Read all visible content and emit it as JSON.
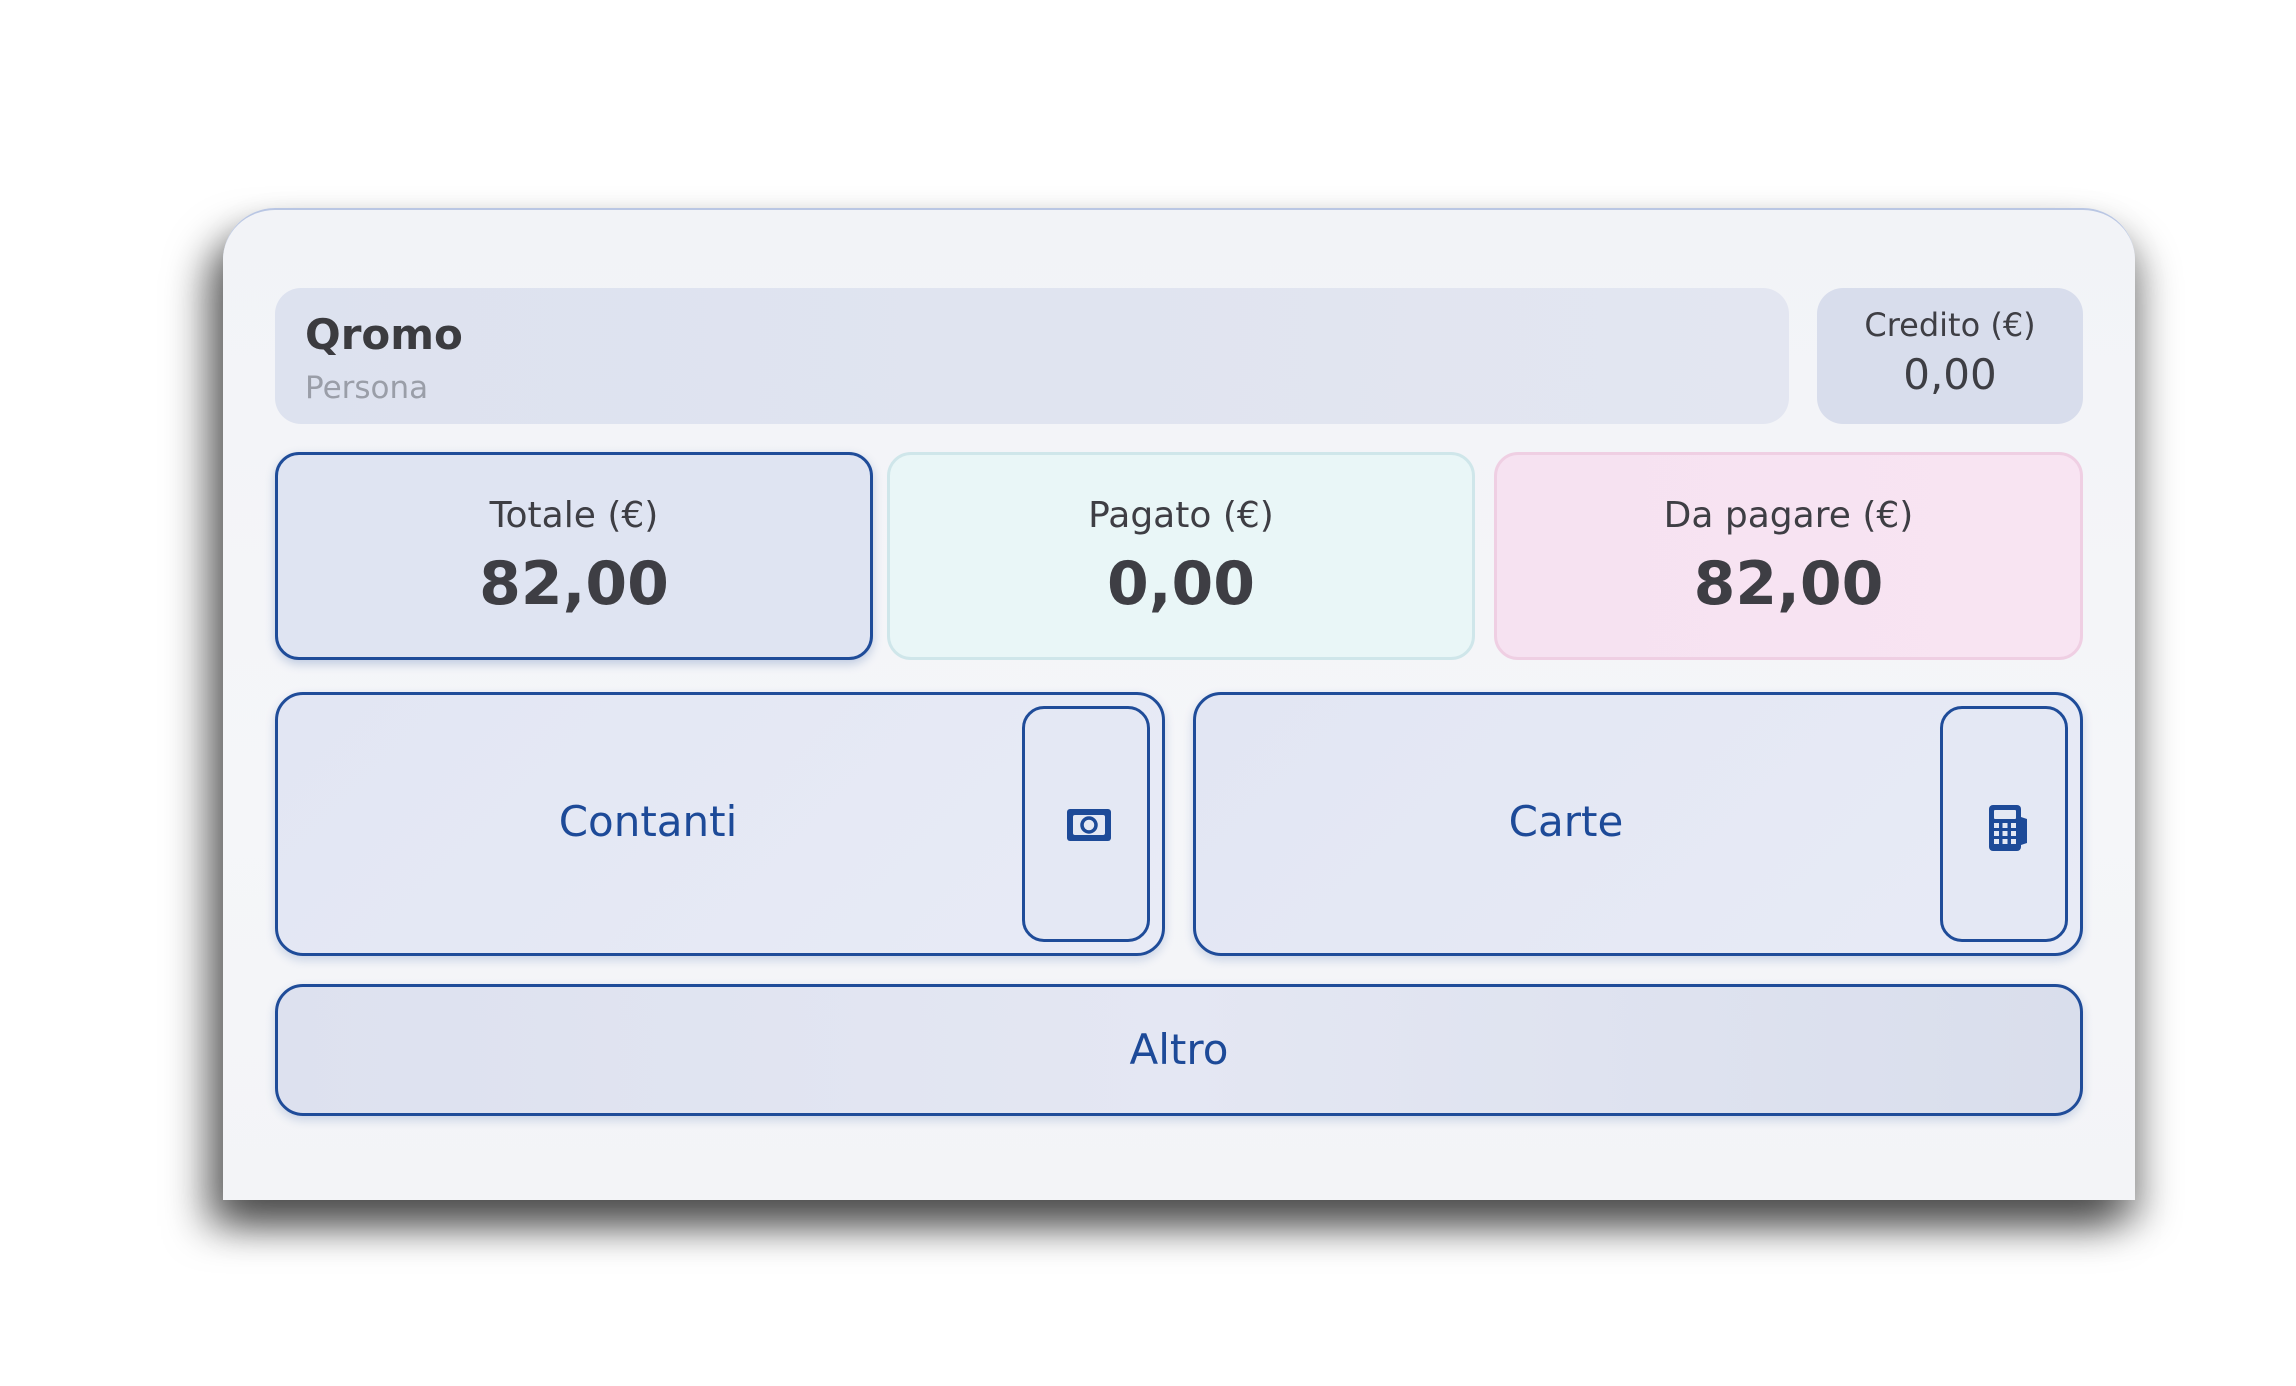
{
  "customer": {
    "name": "Qromo",
    "type": "Persona"
  },
  "credit": {
    "label": "Credito (€)",
    "value": "0,00"
  },
  "summary": {
    "total": {
      "label": "Totale (€)",
      "value": "82,00"
    },
    "paid": {
      "label": "Pagato (€)",
      "value": "0,00"
    },
    "due": {
      "label": "Da pagare (€)",
      "value": "82,00"
    }
  },
  "payment_methods": {
    "cash": {
      "label": "Contanti",
      "icon": "cash-icon"
    },
    "card": {
      "label": "Carte",
      "icon": "card-terminal-icon"
    },
    "other": {
      "label": "Altro"
    }
  },
  "colors": {
    "accent": "#1f4c99",
    "paid_bg": "#e9f6f7",
    "due_bg": "#f6e2f1",
    "total_bg": "#dfe4f2"
  }
}
